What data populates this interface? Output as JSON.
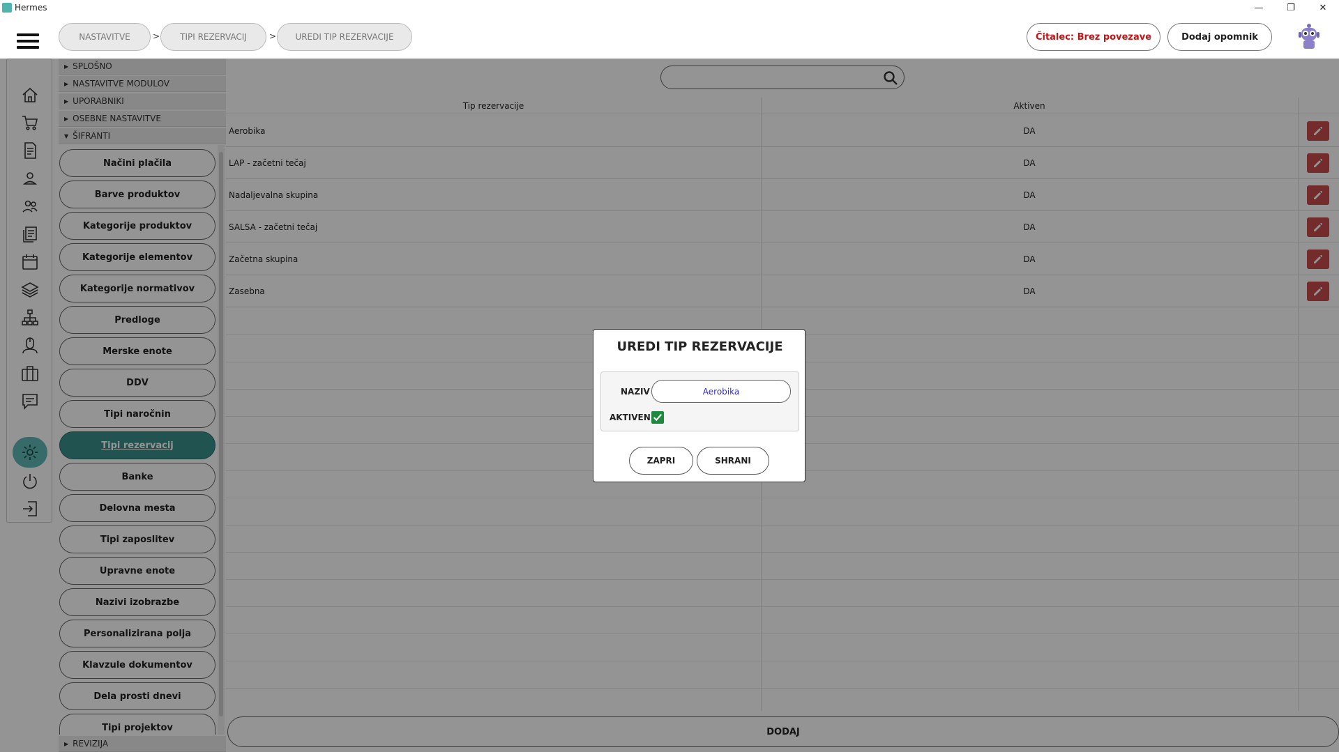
{
  "window": {
    "title": "Hermes",
    "controls": [
      "—",
      "❐",
      "✕"
    ]
  },
  "breadcrumb": {
    "items": [
      "NASTAVITVE",
      "TIPI REZERVACIJ",
      "UREDI TIP REZERVACIJE"
    ],
    "separator": ">"
  },
  "header": {
    "reader_status": "Čitalec: Brez povezave",
    "add_reminder": "Dodaj opomnik"
  },
  "colors": {
    "accent": "#3a8f8b",
    "reader_status": "#c81414",
    "edit_button": "#c94a4a",
    "checkbox": "#1e8a3e"
  },
  "sidebar": {
    "sections": [
      {
        "label": "SPLOŠNO",
        "expanded": false
      },
      {
        "label": "NASTAVITVE MODULOV",
        "expanded": false
      },
      {
        "label": "UPORABNIKI",
        "expanded": false
      },
      {
        "label": "OSEBNE NASTAVITVE",
        "expanded": false
      },
      {
        "label": "ŠIFRANTI",
        "expanded": true
      }
    ],
    "items": [
      "Načini plačila",
      "Barve produktov",
      "Kategorije produktov",
      "Kategorije elementov",
      "Kategorije normativov",
      "Predloge",
      "Merske enote",
      "DDV",
      "Tipi naročnin",
      "Tipi rezervacij",
      "Banke",
      "Delovna mesta",
      "Tipi zaposlitev",
      "Upravne enote",
      "Nazivi izobrazbe",
      "Personalizirana polja",
      "Klavzule dokumentov",
      "Dela prosti dnevi",
      "Tipi projektov"
    ],
    "active_item": "Tipi rezervacij",
    "bottom_section": "REVIZIJA"
  },
  "table": {
    "columns": [
      "Tip rezervacije",
      "Aktiven"
    ],
    "rows": [
      {
        "name": "Aerobika",
        "active": "DA"
      },
      {
        "name": "LAP - začetni tečaj",
        "active": "DA"
      },
      {
        "name": "Nadaljevalna skupina",
        "active": "DA"
      },
      {
        "name": "SALSA - začetni tečaj",
        "active": "DA"
      },
      {
        "name": "Začetna skupina",
        "active": "DA"
      },
      {
        "name": "Zasebna",
        "active": "DA"
      }
    ],
    "add_label": "DODAJ"
  },
  "modal": {
    "title": "UREDI TIP REZERVACIJE",
    "naziv_label": "NAZIV",
    "naziv_value": "Aerobika",
    "aktiven_label": "AKTIVEN",
    "aktiven_checked": true,
    "close_label": "ZAPRI",
    "save_label": "SHRANI"
  },
  "iconbar": {
    "icons": [
      "home-icon",
      "cart-icon",
      "document-icon",
      "person-icon",
      "people-icon",
      "documents-icon",
      "calendar-icon",
      "layers-icon",
      "network-icon",
      "mouse-icon",
      "briefcase-icon",
      "chat-icon",
      "gear-icon",
      "power-icon",
      "logout-icon"
    ],
    "active": "gear-icon"
  }
}
